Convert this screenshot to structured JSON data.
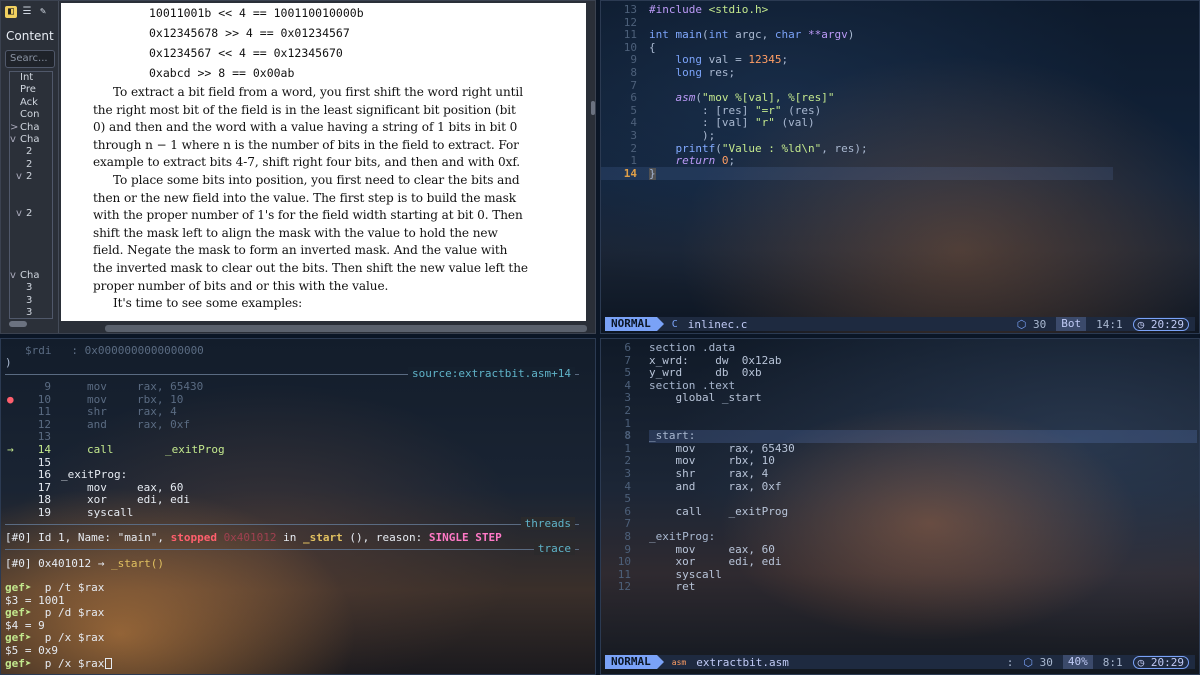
{
  "pdf": {
    "sidebar": {
      "title": "Content",
      "search_placeholder": "Searc...",
      "items": [
        "Int",
        "Pre",
        "Ack",
        "Con",
        "Cha",
        "Cha",
        "2",
        "2",
        "2",
        "2",
        "Cha",
        "3",
        "3",
        "3"
      ],
      "markers": [
        "",
        "",
        "",
        "",
        ">",
        "v",
        "",
        "",
        "v",
        "v",
        "v",
        "",
        "",
        ""
      ]
    },
    "code_lines": [
      "10011001b << 4 == 100110010000b",
      "0x12345678 >> 4 == 0x01234567",
      "0x1234567 << 4 == 0x12345670",
      "0xabcd >> 8 == 0x00ab"
    ],
    "paragraph_lines": [
      "To extract a bit field from a word, you first shift the word right until",
      "the right most bit of the field is in the least significant bit position (bit",
      "0) and then and the word with a value having a string of 1 bits in bit 0",
      "through n − 1 where n is the number of bits in the field to extract.  For",
      "example to extract bits 4-7, shift right four bits, and then and with 0xf.",
      "To place some bits into position, you first need to clear the bits and",
      "then or the new field into the value.  The first step is to build the mask",
      "with the proper number of 1's for the field width starting at bit 0.  Then",
      "shift the mask left to align the mask with the value to hold the new",
      "field.  Negate the mask to form an inverted mask.  And the value with",
      "the inverted mask to clear out the bits.  Then shift the new value left the",
      "proper number of bits and or this with the value.",
      "It's time to see some examples:"
    ]
  },
  "c_editor": {
    "gutter": [
      "13",
      "12",
      "11",
      "10",
      "9",
      "8",
      "7",
      "6",
      "5",
      "4",
      "3",
      "2",
      "1",
      "14"
    ],
    "lines": [
      "#include <stdio.h>",
      "",
      "int main(int argc, char **argv)",
      "{",
      "    long val = 12345;",
      "    long res;",
      "",
      "    asm(\"mov %[val], %[res]\"",
      "        : [res] \"=r\" (res)",
      "        : [val] \"r\" (val)",
      "        );",
      "    printf(\"Value : %ld\\n\", res);",
      "    return 0;",
      "}"
    ],
    "status": {
      "mode": "NORMAL",
      "lang_icon": "C",
      "filename": "inlinec.c",
      "count": "30",
      "position_word": "Bot",
      "cursor": "14:1",
      "clock": "20:29"
    }
  },
  "gdb": {
    "register_line": "$rdi   : 0x0000000000000000",
    "paren": ")",
    "source_label": "source:extractbit.asm+14",
    "code": [
      {
        "num": "9",
        "mn": "mov",
        "op": "rax, 65430"
      },
      {
        "num": "10",
        "mn": "mov",
        "op": "rbx, 10"
      },
      {
        "num": "11",
        "mn": "shr",
        "op": "rax, 4"
      },
      {
        "num": "12",
        "mn": "and",
        "op": "rax, 0xf"
      },
      {
        "num": "13",
        "mn": "",
        "op": ""
      },
      {
        "num": "14",
        "mn": "call",
        "op": "_exitProg"
      },
      {
        "num": "15",
        "mn": "",
        "op": ""
      },
      {
        "num": "16",
        "mn": "_exitProg:",
        "op": ""
      },
      {
        "num": "17",
        "mn": "mov",
        "op": "eax, 60"
      },
      {
        "num": "18",
        "mn": "xor",
        "op": "edi, edi"
      },
      {
        "num": "19",
        "mn": "syscall",
        "op": ""
      }
    ],
    "breakpoint_marker": "●",
    "current_marker": "→",
    "threads_label": "threads",
    "thread_line": {
      "prefix": "[#0] Id 1, Name: \"main\", ",
      "stopped": "stopped",
      "addr": "0x401012",
      "in": " in ",
      "func": "_start",
      "reason_prefix": " (), reason: ",
      "reason": "SINGLE STEP"
    },
    "trace_label": "trace",
    "trace_line": {
      "prefix": "[#0] 0x401012 → ",
      "func": "_start()"
    },
    "console": [
      {
        "prompt": "gef➤  ",
        "cmd": "p /t $rax"
      },
      {
        "prompt": "",
        "cmd": "$3 = 1001"
      },
      {
        "prompt": "gef➤  ",
        "cmd": "p /d $rax"
      },
      {
        "prompt": "",
        "cmd": "$4 = 9"
      },
      {
        "prompt": "gef➤  ",
        "cmd": "p /x $rax"
      },
      {
        "prompt": "",
        "cmd": "$5 = 0x9"
      },
      {
        "prompt": "gef➤  ",
        "cmd": "p /x $rax"
      }
    ]
  },
  "asm_editor": {
    "gutter": [
      "6",
      "7",
      "5",
      "4",
      "3",
      "2",
      "1",
      "8",
      "1",
      "2",
      "3",
      "4",
      "5",
      "6",
      "7",
      "8",
      "9",
      "10",
      "11",
      "12"
    ],
    "lines": [
      "section .data",
      "x_wrd:    dw  0x12ab",
      "y_wrd     db  0xb",
      "section .text",
      "    global _start",
      "",
      "",
      "_start:",
      "    mov     rax, 65430",
      "    mov     rbx, 10",
      "    shr     rax, 4",
      "    and     rax, 0xf",
      "",
      "    call    _exitProg",
      "",
      "_exitProg:",
      "    mov     eax, 60",
      "    xor     edi, edi",
      "    syscall",
      "    ret"
    ],
    "status": {
      "mode": "NORMAL",
      "lang_icon": "asm",
      "filename": "extractbit.asm",
      "colon": ":",
      "count": "30",
      "percent": "40%",
      "cursor": "8:1",
      "clock": "20:29"
    }
  }
}
